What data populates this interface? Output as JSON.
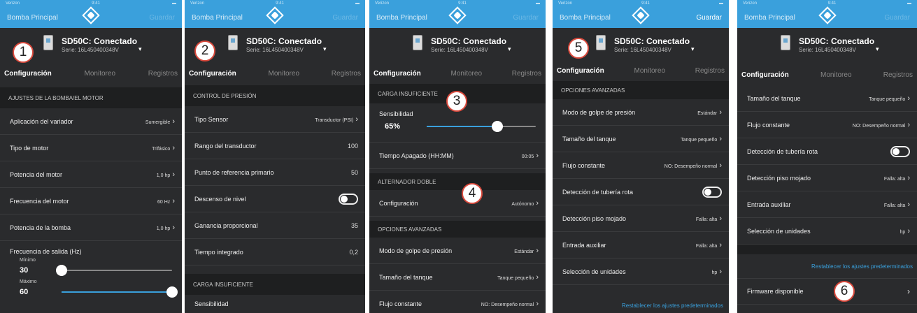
{
  "status_carrier": "Verizon",
  "status_time": "9:41",
  "nav_back": "Bomba Principal",
  "nav_save": "Guardar",
  "device": {
    "name": "SD50C: Conectado",
    "serial": "Serie: 16L450400348V"
  },
  "tabs": [
    "Configuración",
    "Monitoreo",
    "Registros"
  ],
  "badges": [
    "1",
    "2",
    "3",
    "4",
    "5",
    "6"
  ],
  "screen1": {
    "section": "AJUSTES DE LA BOMBA/EL MOTOR",
    "rows": [
      {
        "label": "Aplicación del variador",
        "value": "Sumergible"
      },
      {
        "label": "Tipo de motor",
        "value": "Trifásico"
      },
      {
        "label": "Potencia del motor",
        "value": "1,0 hp"
      },
      {
        "label": "Frecuencia del motor",
        "value": "60 Hz"
      },
      {
        "label": "Potencia de la bomba",
        "value": "1,0 hp"
      }
    ],
    "freq_label": "Frecuencia de salida (Hz)",
    "min_label": "Mínimo",
    "min_value": "30",
    "min_level": 0.0,
    "max_label": "Máximo",
    "max_value": "60",
    "max_level": 1.0
  },
  "screen2": {
    "section": "CONTROL DE PRESIÓN",
    "rows": [
      {
        "label": "Tipo Sensor",
        "value": "Transductor (PSI)",
        "kind": "select"
      },
      {
        "label": "Rango del transductor",
        "value": "100",
        "kind": "num"
      },
      {
        "label": "Punto de referencia primario",
        "value": "50",
        "kind": "num"
      },
      {
        "label": "Descenso de nivel",
        "value": "",
        "kind": "toggle"
      },
      {
        "label": "Ganancia proporcional",
        "value": "35",
        "kind": "num"
      },
      {
        "label": "Tiempo integrado",
        "value": "0,2",
        "kind": "num"
      }
    ],
    "section2": "CARGA INSUFICIENTE",
    "sens_label": "Sensibilidad"
  },
  "screen3": {
    "section": "CARGA INSUFICIENTE",
    "sens_label": "Sensibilidad",
    "sens_value": "65%",
    "sens_level": 0.65,
    "time_label": "Tiempo Apagado (HH:MM)",
    "time_value": "00:05",
    "section2": "ALTERNADOR DOBLE",
    "config_label": "Configuración",
    "config_value": "Autónomo",
    "section3": "OPCIONES AVANZADAS",
    "rows": [
      {
        "label": "Modo de golpe de presión",
        "value": "Estándar"
      },
      {
        "label": "Tamaño del tanque",
        "value": "Tanque pequeño"
      },
      {
        "label": "Flujo constante",
        "value": "NO: Desempeño normal"
      }
    ]
  },
  "screen4": {
    "section": "OPCIONES AVANZADAS",
    "rows": [
      {
        "label": "Modo de golpe de presión",
        "value": "Estándar",
        "kind": "select"
      },
      {
        "label": "Tamaño del tanque",
        "value": "Tanque pequeño",
        "kind": "select"
      },
      {
        "label": "Flujo constante",
        "value": "NO: Desempeño normal",
        "kind": "select"
      },
      {
        "label": "Detección de tubería rota",
        "value": "",
        "kind": "toggle"
      },
      {
        "label": "Detección piso mojado",
        "value": "Falla: alta",
        "kind": "select"
      },
      {
        "label": "Entrada auxiliar",
        "value": "Falla: alta",
        "kind": "select"
      },
      {
        "label": "Selección de unidades",
        "value": "hp",
        "kind": "select"
      }
    ],
    "reset": "Restablecer los ajustes predeterminados"
  },
  "screen5": {
    "rows": [
      {
        "label": "Tamaño del tanque",
        "value": "Tanque pequeño",
        "kind": "select"
      },
      {
        "label": "Flujo constante",
        "value": "NO: Desempeño normal",
        "kind": "select"
      },
      {
        "label": "Detección de tubería rota",
        "value": "",
        "kind": "toggle"
      },
      {
        "label": "Detección piso mojado",
        "value": "Falla: alta",
        "kind": "select"
      },
      {
        "label": "Entrada auxiliar",
        "value": "Falla: alta",
        "kind": "select"
      },
      {
        "label": "Selección de unidades",
        "value": "hp",
        "kind": "select"
      }
    ],
    "reset": "Restablecer los ajustes predeterminados",
    "firmware": "Firmware disponible"
  }
}
